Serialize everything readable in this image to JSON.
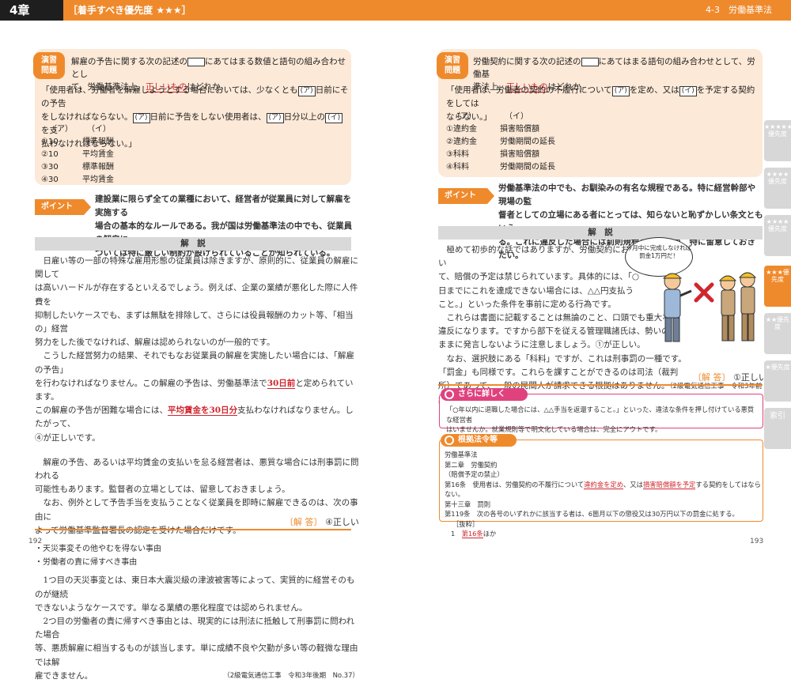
{
  "header": {
    "chapter": "4章",
    "priority": "［着手すべき優先度 ★★★］",
    "section": "4-3　労働基準法"
  },
  "left": {
    "ex_label_1": "演習",
    "ex_label_2": "問題",
    "q1": "解雇の予告に関する次の記述の",
    "q1b": "にあてはまる数値と語句の組み合わせとし",
    "q2a": "て、労働基準法上、",
    "q2red": "正しいもの",
    "q2b": "はどれか。",
    "s1a": "「使用者は、労働者を解雇しようとする場合においては、少なくとも",
    "s1b": "日前にその予告",
    "s2a": "をしなければならない。",
    "s2b": "日前に予告をしない使用者は、",
    "s2c": "日分以上の",
    "s2d": "を支",
    "s3": "払わなければならない。」",
    "box_a": "(ア)",
    "box_i": "(イ)",
    "opt_head_a": "（ア）",
    "opt_head_i": "（イ）",
    "options": [
      {
        "a": "①10",
        "i": "標準報酬"
      },
      {
        "a": "②10",
        "i": "平均賃金"
      },
      {
        "a": "③30",
        "i": "標準報酬"
      },
      {
        "a": "④30",
        "i": "平均賃金"
      }
    ],
    "point_label": "ポイント",
    "point_1": "建設業に限らず全ての業種において、経営者が従業員に対して解雇を実施する",
    "point_2": "場合の基本的なルールである。我が国は労働基準法の中でも、従業員の解雇に",
    "point_3": "ついては特に厳しい制約が設けられていることが知られている。",
    "kaisetsu": "解　説",
    "b1": "日雇い等の一部の特殊な雇用形態の従業員は除きますが、原則的に、従業員の解雇に関して",
    "b2": "は高いハードルが存在するといえるでしょう。例えば、企業の業績が悪化した際に人件費を",
    "b3": "抑制したいケースでも、まずは無駄を排除して、さらには役員報酬のカット等、「相当の」経営",
    "b4": "努力をした後でなければ、解雇は認められないのが一般的です。",
    "b5": "こうした経営努力の結果、それでもなお従業員の解雇を実施したい場合には、「解雇の予告」",
    "b6a": "を行わなければなりません。この解雇の予告は、労働基準法で",
    "b6r": "30日前",
    "b6b": "と定められています。",
    "b7a": "この解雇の予告が困難な場合には、",
    "b7r": "平均賃金を30日分",
    "b7b": "支払わなければなりません。したがって、",
    "b8": "④が正しいです。",
    "b9": "解雇の予告、あるいは平均賃金の支払いを怠る経営者は、悪質な場合には刑事罰に問われる",
    "b10": "可能性もあります。監督者の立場としては、留意しておきましょう。",
    "b11": "なお、例外として予告手当を支払うことなく従業員を即時に解雇できるのは、次の事由に",
    "b12": "よって労働基準監督署長の認定を受けた場合だけです。",
    "li1": "・天災事変その他やむを得ない事由",
    "li2": "・労働者の責に帰すべき事由",
    "b13": "1つ目の天災事変とは、東日本大震災級の津波被害等によって、実質的に経営そのものが継続",
    "b14": "できないようなケースです。単なる業績の悪化程度では認められません。",
    "b15": "2つ目の労働者の責に帰すべき事由とは、現実的には刑法に抵触して刑事罰に問われた場合",
    "b16": "等、悪质解雇に相当するものが該当します。単に成績不良や欠勤が多い等の軽微な理由では解",
    "b17": "雇できません。",
    "cite": "（2級電気通信工事　令和3年後期　No.37）",
    "ans_label": "〔解 答〕",
    "ans_val": "④正しい",
    "page_num": "192"
  },
  "right": {
    "q1a": "労働契約に関する次の記述の",
    "q1b": "にあてはまる語句の組み合わせとして、労働基",
    "q2a": "準法上、",
    "q2red": "正しいもの",
    "q2b": "はどれか。",
    "s1a": "「使用者は、労働者の契約の不履行について",
    "s1b": "を定め、又は",
    "s1c": "を予定する契約をしては",
    "s2": "ならない。」",
    "box_a": "(ア)",
    "box_i": "(イ)",
    "opt_head_a": "（ア）",
    "opt_head_i": "（イ）",
    "options": [
      {
        "a": "①違約金",
        "i": "損害賠償額"
      },
      {
        "a": "②違約金",
        "i": "労働期間の延長"
      },
      {
        "a": "③科料",
        "i": "損害賠償額"
      },
      {
        "a": "④科料",
        "i": "労働期間の延長"
      }
    ],
    "point_label": "ポイント",
    "point_1": "労働基準法の中でも、お馴染みの有名な規程である。特に経営幹部や現場の監",
    "point_2": "督者としての立場にある者にとっては、知らないと恥ずかしい条文ともいえ",
    "point_3": "る。これに違反した場合には罰則規程もあるため、特に留意しておきたい。",
    "kaisetsu": "解　説",
    "b1": "極めて初歩的な話ではありますが、労働契約におい",
    "b2": "て、賠償の予定は禁じられています。具体的には、「○",
    "b3": "日までにこれを達成できない場合には、△△円支払う",
    "b4": "こと。」といった条件を事前に定める行為です。",
    "b5": "これらは書面に記載することは無論のこと、口頭でも重大な",
    "b6": "違反になります。ですから部下を従える管理職諸氏は、勢いの",
    "b7": "ままに発言しないように注意しましょう。①が正しい。",
    "b8": "なお、選択肢にある「科料」ですが、これは刑事罰の一種です。",
    "b9": "「罰金」も同様です。これらを課すことができるのは司法（裁判",
    "b10": "所）であって、一般の民間人が請求できる根拠はありません。",
    "cite": "（2級電気通信工事　令和3年前期　No.37）",
    "bubble": "今月中に完成しなければ罰金1万円だ！",
    "ans_label": "〔解 答〕",
    "ans_val": "①正しい",
    "kw_title": "さらに詳しく",
    "kw_1": "「○年以内に退職した場合には、△△手当を返還すること。」といった、違法な条件を押し付けている悪質な経営者",
    "kw_2": "はいませんか。就業規則等で明文化している場合は、完全にアウトです。",
    "law_title": "根拠法令等",
    "l1": "労働基準法",
    "l2": "第二章　労働契約",
    "l3": "（賠償予定の禁止）",
    "l4a": "第16条　使用者は、労働契約の不履行について",
    "l4r1": "違約金を定め",
    "l4b": "、又は",
    "l4r2": "損害賠償額を予定",
    "l4c": "する契約をしてはならない。",
    "l5": "第十三章　罰則",
    "l6": "第119条　次の各号のいずれかに該当する者は、6箇月以下の懲役又は30万円以下の罰金に処する。",
    "l7": "［抜粋］",
    "l8a": "1　",
    "l8r": "第16条",
    "l8b": "ほか",
    "page_num": "193"
  },
  "tabs": [
    "★★★★★優先度",
    "★★★★優先度",
    "★★★★優先度",
    "★★★優先度",
    "★★優先度",
    "★優先度",
    "索引"
  ]
}
